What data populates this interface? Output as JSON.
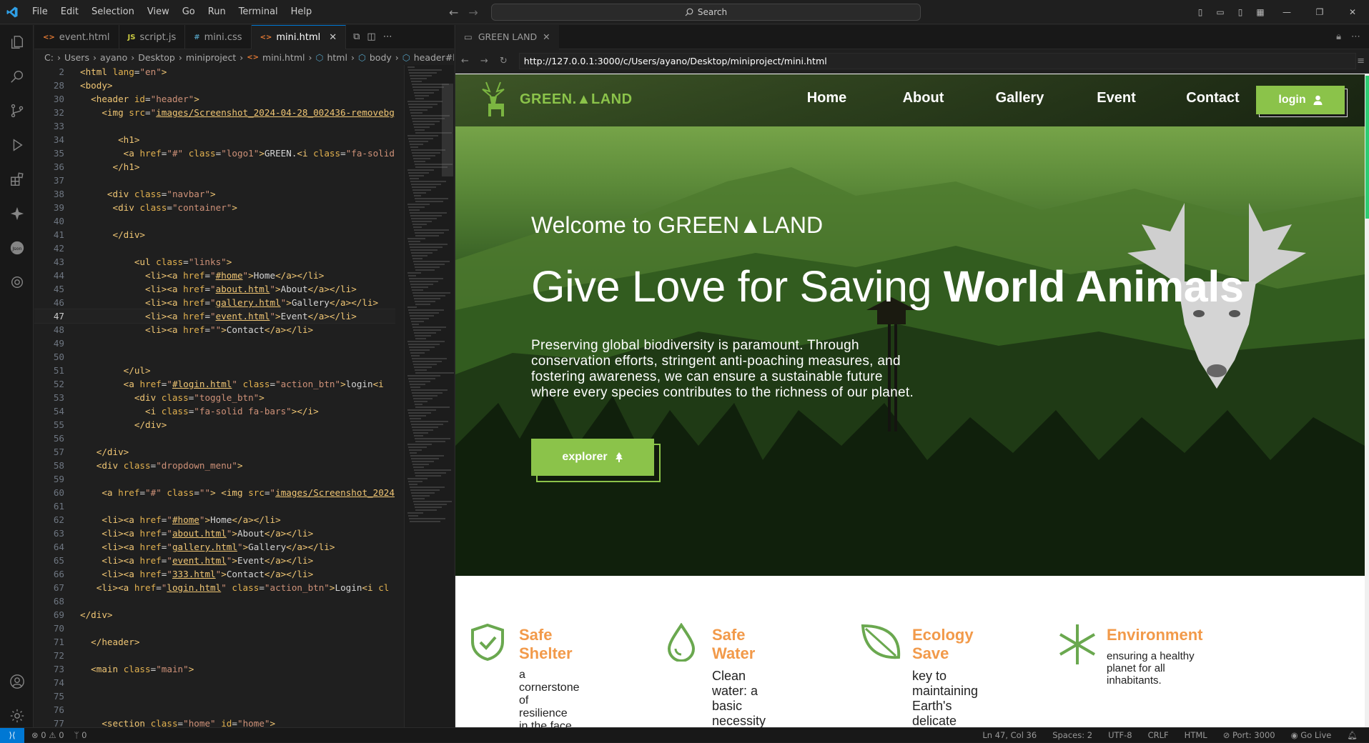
{
  "menu": [
    "File",
    "Edit",
    "Selection",
    "View",
    "Go",
    "Run",
    "Terminal",
    "Help"
  ],
  "search": "Search",
  "tabs": [
    {
      "label": "event.html",
      "icon": "<>",
      "color": "#e37933"
    },
    {
      "label": "script.js",
      "icon": "JS",
      "color": "#cbcb41"
    },
    {
      "label": "mini.css",
      "icon": "#",
      "color": "#519aba"
    },
    {
      "label": "mini.html",
      "icon": "<>",
      "color": "#e37933",
      "active": true
    }
  ],
  "breadcrumbs": [
    "C:",
    "Users",
    "ayano",
    "Desktop",
    "miniproject",
    "mini.html",
    "html",
    "body",
    "header#hea"
  ],
  "code_lines": [
    {
      "n": "2",
      "html": "<span class=\"t\">&lt;html</span> <span class=\"a\">lang</span>=<span class=\"v\">\"en\"</span><span class=\"t\">&gt;</span>"
    },
    {
      "n": "28",
      "html": "<span class=\"t\">&lt;body&gt;</span>"
    },
    {
      "n": "30",
      "html": "  <span class=\"t\">&lt;header</span> <span class=\"a\">id</span>=<span class=\"v\">\"header\"</span><span class=\"t\">&gt;</span>"
    },
    {
      "n": "32",
      "html": "    <span class=\"t\">&lt;img</span> <span class=\"a\">src</span>=<span class=\"v\">\"</span><span class=\"u\">images/Screenshot_2024-04-28_002436-removebg</span>"
    },
    {
      "n": "33",
      "html": ""
    },
    {
      "n": "34",
      "html": "       <span class=\"t\">&lt;h1&gt;</span>"
    },
    {
      "n": "35",
      "html": "        <span class=\"t\">&lt;a</span> <span class=\"a\">href</span>=<span class=\"v\">\"#\"</span> <span class=\"a\">class</span>=<span class=\"v\">\"logo1\"</span><span class=\"t\">&gt;</span>GREEN.<span class=\"t\">&lt;i</span> <span class=\"a\">class</span>=<span class=\"v\">\"fa-solid</span>"
    },
    {
      "n": "36",
      "html": "      <span class=\"t\">&lt;/h1&gt;</span>"
    },
    {
      "n": "37",
      "html": ""
    },
    {
      "n": "38",
      "html": "     <span class=\"t\">&lt;div</span> <span class=\"a\">class</span>=<span class=\"v\">\"navbar\"</span><span class=\"t\">&gt;</span>"
    },
    {
      "n": "39",
      "html": "      <span class=\"t\">&lt;div</span> <span class=\"a\">class</span>=<span class=\"v\">\"container\"</span><span class=\"t\">&gt;</span>"
    },
    {
      "n": "40",
      "html": ""
    },
    {
      "n": "41",
      "html": "      <span class=\"t\">&lt;/div&gt;</span>"
    },
    {
      "n": "42",
      "html": ""
    },
    {
      "n": "43",
      "html": "          <span class=\"t\">&lt;ul</span> <span class=\"a\">class</span>=<span class=\"v\">\"links\"</span><span class=\"t\">&gt;</span>"
    },
    {
      "n": "44",
      "html": "            <span class=\"t\">&lt;li&gt;&lt;a</span> <span class=\"a\">href</span>=<span class=\"v\">\"</span><span class=\"u\">#home</span><span class=\"v\">\"</span><span class=\"t\">&gt;</span>Home<span class=\"t\">&lt;/a&gt;&lt;/li&gt;</span>"
    },
    {
      "n": "45",
      "html": "            <span class=\"t\">&lt;li&gt;&lt;a</span> <span class=\"a\">href</span>=<span class=\"v\">\"</span><span class=\"u\">about.html</span><span class=\"v\">\"</span><span class=\"t\">&gt;</span>About<span class=\"t\">&lt;/a&gt;&lt;/li&gt;</span>"
    },
    {
      "n": "46",
      "html": "            <span class=\"t\">&lt;li&gt;&lt;a</span> <span class=\"a\">href</span>=<span class=\"v\">\"</span><span class=\"u\">gallery.html</span><span class=\"v\">\"</span><span class=\"t\">&gt;</span>Gallery<span class=\"t\">&lt;/a&gt;&lt;/li&gt;</span>"
    },
    {
      "n": "47",
      "html": "            <span class=\"t\">&lt;li&gt;&lt;a</span> <span class=\"a\">href</span>=<span class=\"v\">\"</span><span class=\"u\">event.html</span><span class=\"v\">\"</span><span class=\"t\">&gt;</span>Event<span class=\"t\">&lt;/a&gt;&lt;/li&gt;</span>",
      "cur": true
    },
    {
      "n": "48",
      "html": "            <span class=\"t\">&lt;li&gt;&lt;a</span> <span class=\"a\">href</span>=<span class=\"v\">\"\"</span><span class=\"t\">&gt;</span>Contact<span class=\"t\">&lt;/a&gt;&lt;/li&gt;</span>"
    },
    {
      "n": "49",
      "html": ""
    },
    {
      "n": "50",
      "html": ""
    },
    {
      "n": "51",
      "html": "        <span class=\"t\">&lt;/ul&gt;</span>"
    },
    {
      "n": "52",
      "html": "        <span class=\"t\">&lt;a</span> <span class=\"a\">href</span>=<span class=\"v\">\"</span><span class=\"u\">#login.html</span><span class=\"v\">\"</span> <span class=\"a\">class</span>=<span class=\"v\">\"action_btn\"</span><span class=\"t\">&gt;</span>login<span class=\"t\">&lt;i</span>"
    },
    {
      "n": "53",
      "html": "          <span class=\"t\">&lt;div</span> <span class=\"a\">class</span>=<span class=\"v\">\"toggle_btn\"</span><span class=\"t\">&gt;</span>"
    },
    {
      "n": "54",
      "html": "            <span class=\"t\">&lt;i</span> <span class=\"a\">class</span>=<span class=\"v\">\"fa-solid fa-bars\"</span><span class=\"t\">&gt;&lt;/i&gt;</span>"
    },
    {
      "n": "55",
      "html": "          <span class=\"t\">&lt;/div&gt;</span>"
    },
    {
      "n": "56",
      "html": ""
    },
    {
      "n": "57",
      "html": "   <span class=\"t\">&lt;/div&gt;</span>"
    },
    {
      "n": "58",
      "html": "   <span class=\"t\">&lt;div</span> <span class=\"a\">class</span>=<span class=\"v\">\"dropdown_menu\"</span><span class=\"t\">&gt;</span>"
    },
    {
      "n": "59",
      "html": ""
    },
    {
      "n": "60",
      "html": "    <span class=\"t\">&lt;a</span> <span class=\"a\">href</span>=<span class=\"v\">\"#\"</span> <span class=\"a\">class</span>=<span class=\"v\">\"\"</span><span class=\"t\">&gt;</span> <span class=\"t\">&lt;img</span> <span class=\"a\">src</span>=<span class=\"v\">\"</span><span class=\"u\">images/Screenshot_2024</span>"
    },
    {
      "n": "61",
      "html": ""
    },
    {
      "n": "62",
      "html": "    <span class=\"t\">&lt;li&gt;&lt;a</span> <span class=\"a\">href</span>=<span class=\"v\">\"</span><span class=\"u\">#home</span><span class=\"v\">\"</span><span class=\"t\">&gt;</span>Home<span class=\"t\">&lt;/a&gt;&lt;/li&gt;</span>"
    },
    {
      "n": "63",
      "html": "    <span class=\"t\">&lt;li&gt;&lt;a</span> <span class=\"a\">href</span>=<span class=\"v\">\"</span><span class=\"u\">about.html</span><span class=\"v\">\"</span><span class=\"t\">&gt;</span>About<span class=\"t\">&lt;/a&gt;&lt;/li&gt;</span>"
    },
    {
      "n": "64",
      "html": "    <span class=\"t\">&lt;li&gt;&lt;a</span> <span class=\"a\">href</span>=<span class=\"v\">\"</span><span class=\"u\">gallery.html</span><span class=\"v\">\"</span><span class=\"t\">&gt;</span>Gallery<span class=\"t\">&lt;/a&gt;&lt;/li&gt;</span>"
    },
    {
      "n": "65",
      "html": "    <span class=\"t\">&lt;li&gt;&lt;a</span> <span class=\"a\">href</span>=<span class=\"v\">\"</span><span class=\"u\">event.html</span><span class=\"v\">\"</span><span class=\"t\">&gt;</span>Event<span class=\"t\">&lt;/a&gt;&lt;/li&gt;</span>"
    },
    {
      "n": "66",
      "html": "    <span class=\"t\">&lt;li&gt;&lt;a</span> <span class=\"a\">href</span>=<span class=\"v\">\"</span><span class=\"u\">333.html</span><span class=\"v\">\"</span><span class=\"t\">&gt;</span>Contact<span class=\"t\">&lt;/a&gt;&lt;/li&gt;</span>"
    },
    {
      "n": "67",
      "html": "   <span class=\"t\">&lt;li&gt;&lt;a</span> <span class=\"a\">href</span>=<span class=\"v\">\"</span><span class=\"u\">login.html</span><span class=\"v\">\"</span> <span class=\"a\">class</span>=<span class=\"v\">\"action_btn\"</span><span class=\"t\">&gt;</span>Login<span class=\"t\">&lt;i</span> <span class=\"a\">cl</span>"
    },
    {
      "n": "68",
      "html": ""
    },
    {
      "n": "69",
      "html": "<span class=\"t\">&lt;/div&gt;</span>"
    },
    {
      "n": "70",
      "html": ""
    },
    {
      "n": "71",
      "html": "  <span class=\"t\">&lt;/header&gt;</span>"
    },
    {
      "n": "72",
      "html": ""
    },
    {
      "n": "73",
      "html": "  <span class=\"t\">&lt;main</span> <span class=\"a\">class</span>=<span class=\"v\">\"main\"</span><span class=\"t\">&gt;</span>"
    },
    {
      "n": "74",
      "html": ""
    },
    {
      "n": "75",
      "html": ""
    },
    {
      "n": "76",
      "html": ""
    },
    {
      "n": "77",
      "html": "    <span class=\"t\">&lt;section</span> <span class=\"a\">class</span>=<span class=\"v\">\"home\"</span> <span class=\"a\">id</span>=<span class=\"v\">\"home\"</span><span class=\"t\">&gt;</span>"
    }
  ],
  "browser": {
    "tab_title": "GREEN LAND",
    "url": "http://127.0.0.1:3000/c/Users/ayano/Desktop/miniproject/mini.html"
  },
  "site": {
    "brand": "GREEN.▲LAND",
    "nav": [
      "Home",
      "About",
      "Gallery",
      "Event",
      "Contact"
    ],
    "login": "login",
    "welcome": "Welcome to GREEN▲LAND",
    "headline_regular": "Give Love for Saving ",
    "headline_bold": "World Animals",
    "paragraph": "Preserving global biodiversity is paramount. Through conservation efforts, stringent anti-poaching measures, and fostering awareness, we can ensure a sustainable future where every species contributes to the richness of our planet.",
    "explore": "explorer",
    "features": [
      {
        "title": "Safe Shelter",
        "text": "a cornerstone of resilience in the face of adversity"
      },
      {
        "title": "Safe Water",
        "text": "Clean water: a basic necessity for"
      },
      {
        "title": "Ecology Save",
        "text": "key to maintaining Earth's delicate"
      },
      {
        "title": "Environment",
        "text": "ensuring a healthy planet for all inhabitants."
      }
    ]
  },
  "status": {
    "errors": "0",
    "warnings": "0",
    "ports": "0",
    "position": "Ln 47, Col 36",
    "spaces": "Spaces: 2",
    "encoding": "UTF-8",
    "eol": "CRLF",
    "language": "HTML",
    "port": "Port: 3000",
    "golive": "Go Live"
  },
  "colors": {
    "accent": "#8bc34a",
    "feature_title": "#f29a4a",
    "vscode_blue": "#0078d4"
  }
}
